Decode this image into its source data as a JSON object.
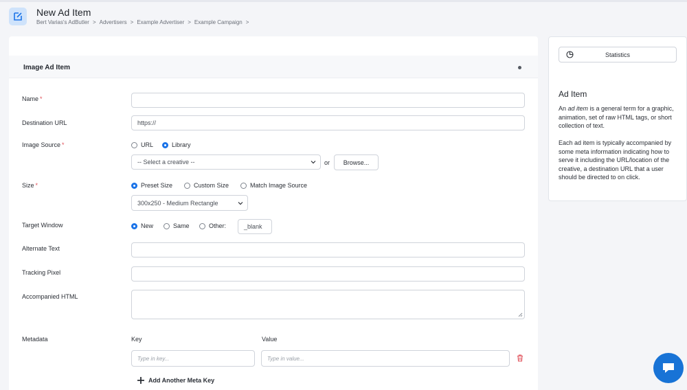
{
  "page": {
    "title": "New Ad Item",
    "breadcrumb": [
      "Bert Varias's AdButler",
      "Advertisers",
      "Example Advertiser",
      "Example Campaign"
    ],
    "breadcrumb_separator": ">",
    "accent_color": "#1a73e8"
  },
  "form": {
    "section_title": "Image Ad Item",
    "name_label": "Name",
    "name_value": "",
    "required_marker": "*",
    "destination_label": "Destination URL",
    "destination_value": "https://",
    "image_source_label": "Image Source",
    "image_source_options": [
      "URL",
      "Library"
    ],
    "image_source_selected": "Library",
    "creative_select_value": "-- Select a creative --",
    "or_text": "or",
    "browse_label": "Browse...",
    "size_label": "Size",
    "size_options": [
      "Preset Size",
      "Custom Size",
      "Match Image Source"
    ],
    "size_selected": "Preset Size",
    "size_select_value": "300x250 - Medium Rectangle",
    "target_label": "Target Window",
    "target_options": [
      "New",
      "Same",
      "Other:"
    ],
    "target_selected": "New",
    "target_other_value": "_blank",
    "alt_text_label": "Alternate Text",
    "alt_text_value": "",
    "tracking_label": "Tracking Pixel",
    "tracking_value": "",
    "html_label": "Accompanied HTML",
    "html_value": "",
    "metadata_label": "Metadata",
    "key_header": "Key",
    "value_header": "Value",
    "key_placeholder": "Type in key...",
    "value_placeholder": "Type in value...",
    "add_meta_label": "Add Another Meta Key"
  },
  "sidebar": {
    "statistics_label": "Statistics",
    "info_title": "Ad Item",
    "para1_prefix": "An ",
    "para1_em": "ad item",
    "para1_suffix": " is a general term for a graphic, animation, set of raw HTML tags, or short collection of text.",
    "para2": "Each ad item is typically accompanied by some meta information indicating how to serve it including the URL/location of the creative, a destination URL that a user should be directed to on click."
  },
  "icons": {
    "page": "edit-icon",
    "statistics": "pie-chart-icon",
    "delete": "trash-icon",
    "add": "plus-icon",
    "chat": "chat-icon",
    "delete_color": "#e0505a",
    "chat_color": "#1873d6"
  }
}
